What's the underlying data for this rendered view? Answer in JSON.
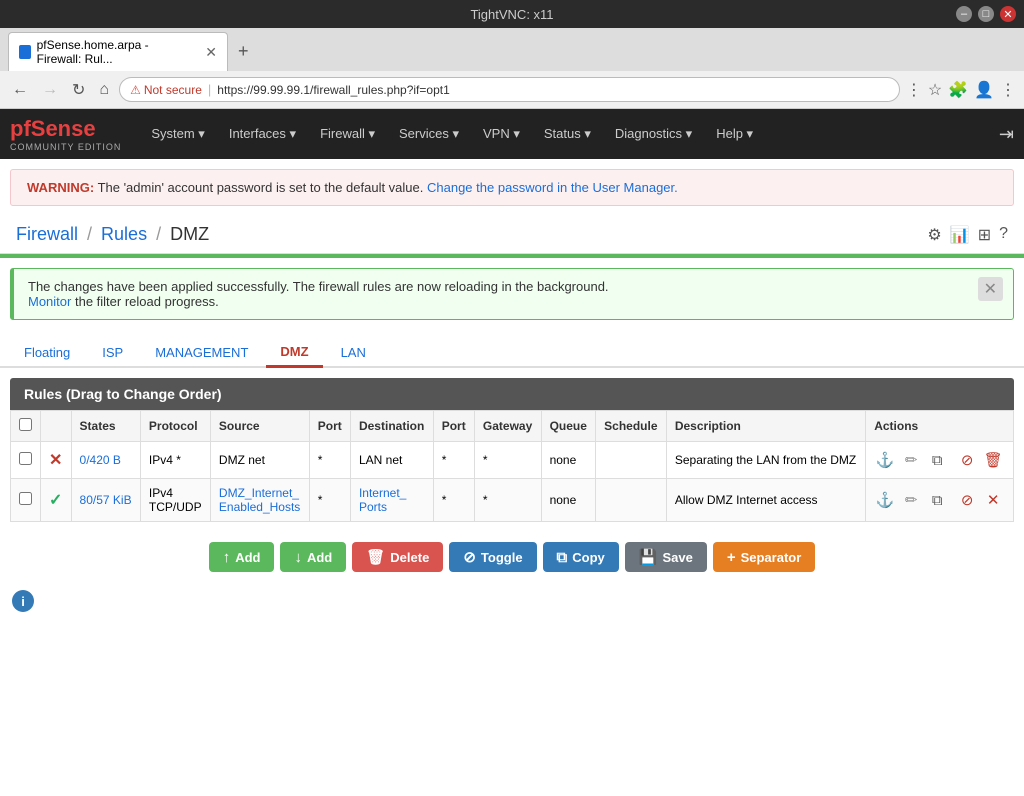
{
  "titlebar": {
    "title": "TightVNC: x11",
    "minimize_label": "–",
    "maximize_label": "□",
    "close_label": "✕"
  },
  "browser": {
    "tab_title": "pfSense.home.arpa - Firewall: Rul...",
    "new_tab_label": "+",
    "url": "https://99.99.99.1/firewall_rules.php?if=opt1",
    "security_label": "Not secure",
    "overflow_btn": "⋮"
  },
  "nav": {
    "logo_main": "pfSense",
    "logo_sub": "COMMUNITY EDITION",
    "items": [
      {
        "label": "System",
        "id": "system"
      },
      {
        "label": "Interfaces",
        "id": "interfaces"
      },
      {
        "label": "Firewall",
        "id": "firewall"
      },
      {
        "label": "Services",
        "id": "services"
      },
      {
        "label": "VPN",
        "id": "vpn"
      },
      {
        "label": "Status",
        "id": "status"
      },
      {
        "label": "Diagnostics",
        "id": "diagnostics"
      },
      {
        "label": "Help",
        "id": "help"
      }
    ],
    "logout_icon": "⇥"
  },
  "warning": {
    "prefix": "WARNING:",
    "text": " The 'admin' account password is set to the default value. ",
    "link_text": "Change the password in the User Manager.",
    "link_href": "#"
  },
  "breadcrumb": {
    "firewall": "Firewall",
    "rules": "Rules",
    "current": "DMZ",
    "sep": "/"
  },
  "header_icons": [
    "≡≡",
    "📊",
    "⊞",
    "?"
  ],
  "success_alert": {
    "text": "The changes have been applied successfully. The firewall rules are now reloading in the background.",
    "link_text": "Monitor",
    "link_suffix": " the filter reload progress.",
    "close_icon": "✕"
  },
  "tabs": [
    {
      "label": "Floating",
      "id": "floating",
      "active": false
    },
    {
      "label": "ISP",
      "id": "isp",
      "active": false
    },
    {
      "label": "MANAGEMENT",
      "id": "management",
      "active": false
    },
    {
      "label": "DMZ",
      "id": "dmz",
      "active": true
    },
    {
      "label": "LAN",
      "id": "lan",
      "active": false
    }
  ],
  "rules_table": {
    "header": "Rules (Drag to Change Order)",
    "columns": [
      "",
      "",
      "States",
      "Protocol",
      "Source",
      "Port",
      "Destination",
      "Port",
      "Gateway",
      "Queue",
      "Schedule",
      "Description",
      "Actions"
    ],
    "rows": [
      {
        "enabled": false,
        "state_badge": "✕",
        "state_color": "red",
        "states": "0/420 B",
        "protocol": "IPv4 *",
        "source": "DMZ net",
        "port_src": "*",
        "destination": "LAN net",
        "port_dst": "*",
        "gateway": "*",
        "queue": "none",
        "schedule": "",
        "description": "Separating the LAN from the DMZ",
        "actions": [
          "anchor",
          "edit",
          "copy",
          "disable",
          "delete"
        ]
      },
      {
        "enabled": true,
        "state_badge": "✓",
        "state_color": "green",
        "states": "80/57 KiB",
        "protocol": "IPv4 TCP/UDP",
        "source": "DMZ_Internet_Enabled_Hosts",
        "port_src": "*",
        "destination": "Internet_Ports",
        "port_dst": "*",
        "gateway": "*",
        "queue": "none",
        "schedule": "",
        "description": "Allow DMZ Internet access",
        "actions": [
          "anchor",
          "edit",
          "copy",
          "disable",
          "delete"
        ]
      }
    ]
  },
  "toolbar": {
    "buttons": [
      {
        "label": "Add",
        "color": "green",
        "icon": "↑",
        "id": "add-up"
      },
      {
        "label": "Add",
        "color": "green",
        "icon": "↓",
        "id": "add-down"
      },
      {
        "label": "Delete",
        "color": "red",
        "icon": "🗑",
        "id": "delete"
      },
      {
        "label": "Toggle",
        "color": "blue",
        "icon": "⊘",
        "id": "toggle"
      },
      {
        "label": "Copy",
        "color": "blue",
        "icon": "⧉",
        "id": "copy"
      },
      {
        "label": "Save",
        "color": "gray",
        "icon": "💾",
        "id": "save"
      },
      {
        "label": "Separator",
        "color": "orange",
        "icon": "+",
        "id": "separator"
      }
    ]
  },
  "info_icon": "i"
}
